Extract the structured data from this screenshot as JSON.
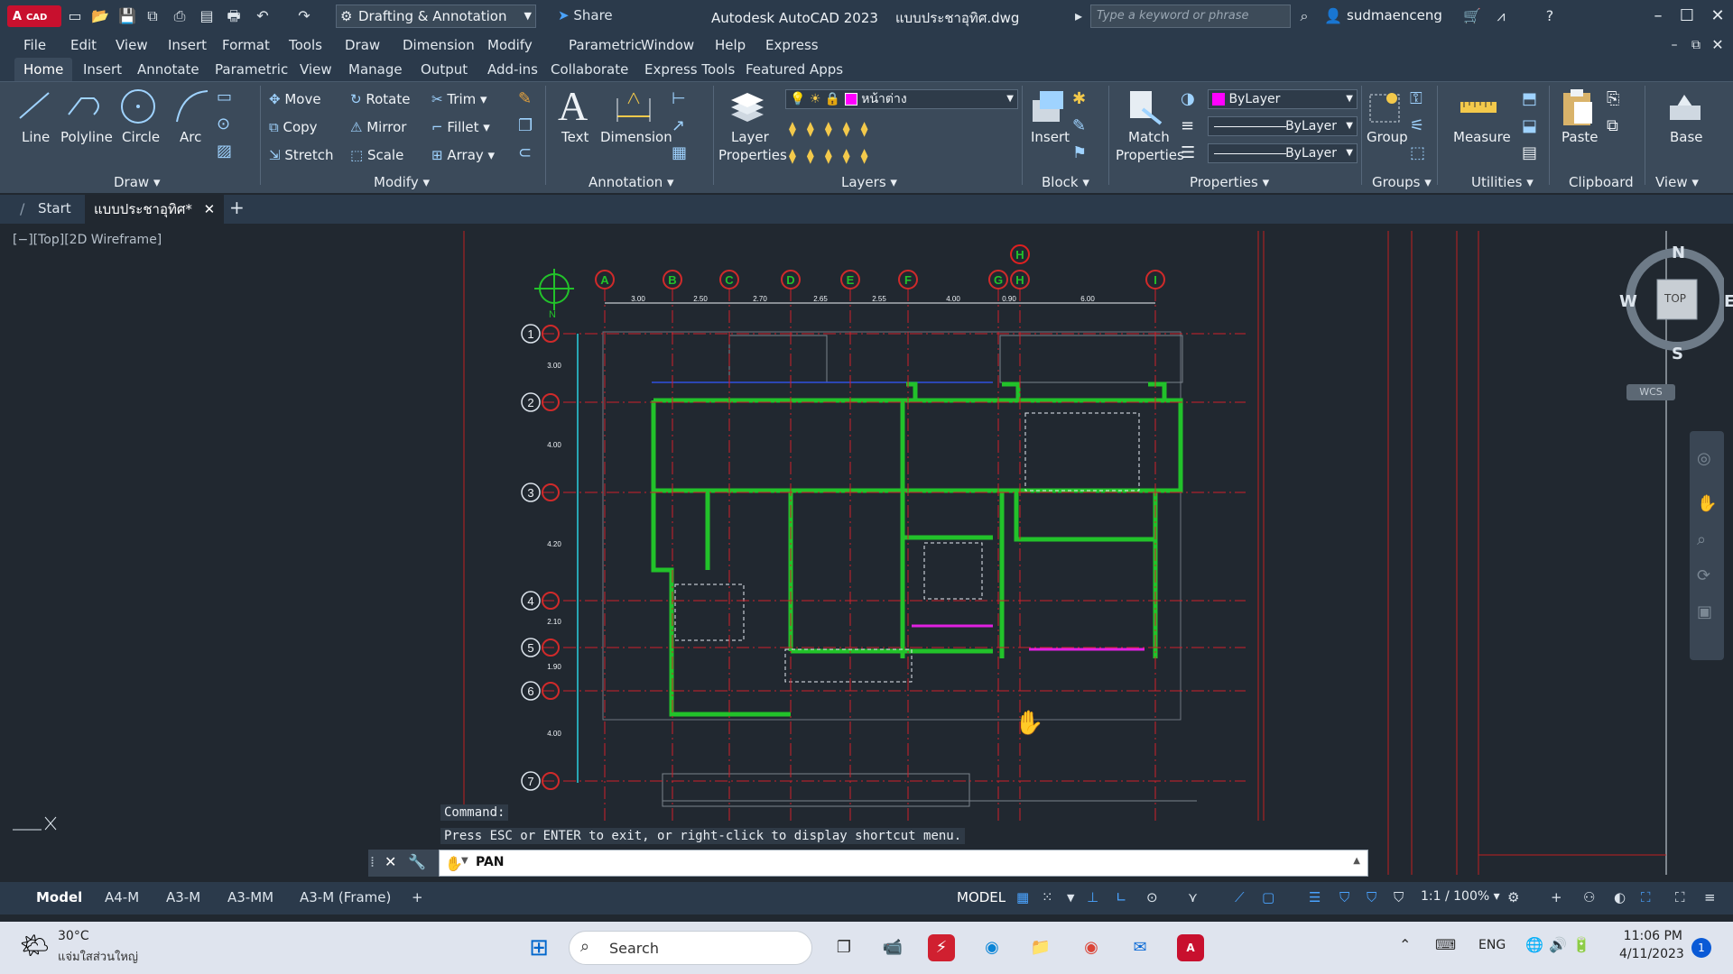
{
  "titlebar": {
    "logo_label": "CAD",
    "workspace": "Drafting & Annotation",
    "share_label": "Share",
    "app_title": "Autodesk AutoCAD 2023    แบบประชาอุทิศ.dwg",
    "search_placeholder": "Type a keyword or phrase",
    "username": "sudmaenceng"
  },
  "menubar": [
    "File",
    "Edit",
    "View",
    "Insert",
    "Format",
    "Tools",
    "Draw",
    "Dimension",
    "Modify",
    "Parametric",
    "Window",
    "Help",
    "Express"
  ],
  "ribbon_tabs": [
    "Home",
    "Insert",
    "Annotate",
    "Parametric",
    "View",
    "Manage",
    "Output",
    "Add-ins",
    "Collaborate",
    "Express Tools",
    "Featured Apps"
  ],
  "ribbon": {
    "draw": {
      "label": "Draw",
      "line": "Line",
      "polyline": "Polyline",
      "circle": "Circle",
      "arc": "Arc"
    },
    "modify": {
      "label": "Modify",
      "move": "Move",
      "rotate": "Rotate",
      "trim": "Trim",
      "copy": "Copy",
      "mirror": "Mirror",
      "fillet": "Fillet",
      "stretch": "Stretch",
      "scale": "Scale",
      "array": "Array"
    },
    "annotation": {
      "label": "Annotation",
      "text": "Text",
      "dimension": "Dimension"
    },
    "layers": {
      "label": "Layers",
      "layer_properties_1": "Layer",
      "layer_properties_2": "Properties",
      "current_layer": "หน้าต่าง",
      "layer_color": "#ff00ff"
    },
    "block": {
      "label": "Block",
      "insert": "Insert"
    },
    "properties": {
      "label": "Properties",
      "match_1": "Match",
      "match_2": "Properties",
      "color": "ByLayer",
      "linetype": "ByLayer",
      "lineweight": "ByLayer"
    },
    "groups": {
      "label": "Groups",
      "group": "Group"
    },
    "utilities": {
      "label": "Utilities",
      "measure": "Measure"
    },
    "clipboard": {
      "label": "Clipboard",
      "paste": "Paste"
    },
    "view": {
      "label": "View",
      "base": "Base"
    }
  },
  "doc_tabs": {
    "start": "Start",
    "active": "แบบประชาอุทิศ*"
  },
  "viewport": {
    "label": "[−][Top][2D Wireframe]",
    "viewcube": {
      "n": "N",
      "s": "S",
      "e": "E",
      "w": "W",
      "top": "TOP",
      "wcs": "WCS"
    }
  },
  "drawing": {
    "grid_cols": [
      "A",
      "B",
      "C",
      "D",
      "E",
      "F",
      "G",
      "H",
      "H",
      "I"
    ],
    "grid_rows": [
      "1",
      "2",
      "3",
      "4",
      "5",
      "6",
      "7"
    ],
    "col_dims": [
      "3.00",
      "2.50",
      "2.70",
      "2.65",
      "2.55",
      "4.00",
      "0.90",
      "6.00"
    ],
    "row_dims": [
      "3.00",
      "4.00",
      "4.20",
      "2.10",
      "1.90",
      "4.00"
    ]
  },
  "command": {
    "hist1": "Command:",
    "hist2": "Press ESC or ENTER to exit, or right-click to display shortcut menu.",
    "current": "PAN"
  },
  "layout_tabs": [
    "Model",
    "A4-M",
    "A3-M",
    "A3-MM",
    "A3-M (Frame)"
  ],
  "status": {
    "model": "MODEL",
    "scale": "1:1 / 100%"
  },
  "taskbar": {
    "temp": "30°C",
    "weather": "แจ่มใสส่วนใหญ่",
    "search": "Search",
    "lang": "ENG",
    "time": "11:06 PM",
    "date": "4/11/2023",
    "notif": "1"
  }
}
